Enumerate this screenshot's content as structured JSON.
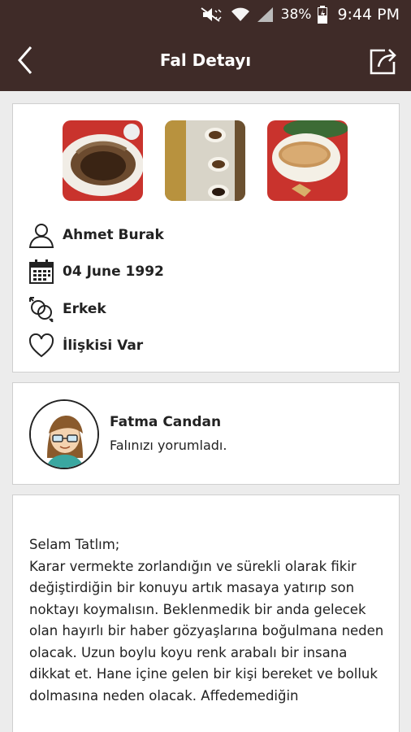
{
  "status_bar": {
    "battery": "38%",
    "time": "9:44 PM",
    "icons": [
      "mute-icon",
      "wifi-icon",
      "signal-icon",
      "battery-icon"
    ]
  },
  "app_bar": {
    "title": "Fal Detayı",
    "back_icon": "chevron-left-icon",
    "share_icon": "share-icon"
  },
  "fortune": {
    "photos": [
      "coffee-cup-photo",
      "coffee-cups-photo",
      "coffee-saucer-photo"
    ],
    "name": "Ahmet Burak",
    "birth_date": "04 June 1992",
    "gender": "Erkek",
    "relationship": "İlişkisi Var"
  },
  "commenter": {
    "name": "Fatma Candan",
    "action": "Falınızı yorumladı."
  },
  "reading": {
    "text": "Selam Tatlım;\nKarar vermekte zorlandığın ve sürekli olarak fikir değiştirdiğin bir konuyu artık masaya yatırıp son noktayı koymalısın.  Beklenmedik bir anda gelecek olan hayırlı bir haber gözyaşlarına boğulmana neden olacak. Uzun boylu koyu renk arabalı bir insana dikkat et. Hane içine gelen bir kişi bereket ve bolluk dolmasına neden olacak. Affedemediğin"
  },
  "colors": {
    "app_bar": "#3f2b28",
    "background": "#ececec",
    "card": "#ffffff"
  }
}
